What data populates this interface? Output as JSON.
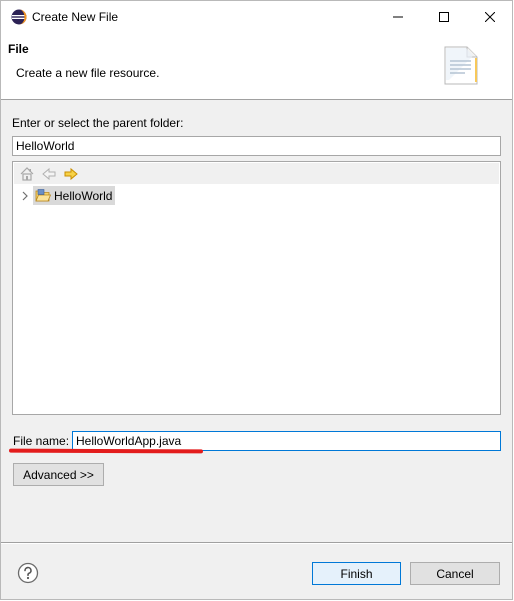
{
  "window": {
    "title": "Create New File",
    "controls": {
      "minimize": "minimize-icon",
      "maximize": "maximize-icon",
      "close": "close-icon"
    }
  },
  "header": {
    "title": "File",
    "description": "Create a new file resource.",
    "icon": "new-file-wizard-icon"
  },
  "parent_folder": {
    "label": "Enter or select the parent folder:",
    "value": "HelloWorld",
    "toolbar_icons": [
      "home-icon",
      "back-icon",
      "forward-icon"
    ],
    "tree": [
      {
        "label": "HelloWorld",
        "icon": "project-folder-icon",
        "expanded": false,
        "selected": true
      }
    ]
  },
  "file_name": {
    "label": "File name:",
    "value": "HelloWorldApp.java"
  },
  "advanced": {
    "label": "Advanced >>"
  },
  "footer": {
    "help_icon": "help-icon",
    "finish_label": "Finish",
    "cancel_label": "Cancel"
  },
  "colors": {
    "accent": "#0078d7",
    "annotation_underline": "#e31c1c",
    "window_bg": "#f0f0f0"
  }
}
